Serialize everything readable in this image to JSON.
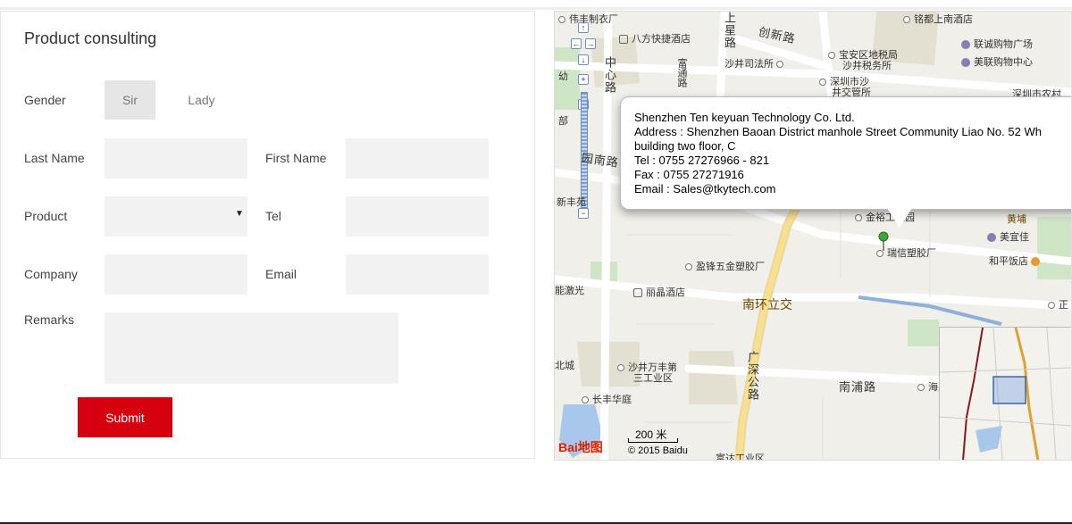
{
  "form": {
    "title": "Product consulting",
    "gender_label": "Gender",
    "gender_sir": "Sir",
    "gender_lady": "Lady",
    "last_name_label": "Last Name",
    "first_name_label": "First Name",
    "product_label": "Product",
    "tel_label": "Tel",
    "company_label": "Company",
    "email_label": "Email",
    "remarks_label": "Remarks",
    "submit_label": "Submit"
  },
  "map": {
    "popup": {
      "company": "Shenzhen Ten keyuan Technology Co. Ltd.",
      "address": "Address : Shenzhen Baoan District manhole Street Community Liao No. 52 Wh",
      "address2": "building two floor, C",
      "tel": "Tel : 0755 27276966 - 821",
      "fax": "Fax : 0755 27271916",
      "email": "Email : Sales@tkytech.com"
    },
    "labels": {
      "l1": "伟丰制衣厂",
      "l2": "八方快捷酒店",
      "l3": "上星路",
      "l4": "创新路",
      "l5": "沙井司法所",
      "l6": "宝安区地税局",
      "l6b": "沙井税务所",
      "l7": "联诚购物广场",
      "l8": "美联购物中心",
      "l9": "中心路",
      "l10": "富通路",
      "l11": "深圳市沙",
      "l11b": "井交管所",
      "l12": "深圳市农村",
      "l13": "园南路",
      "l14": "新丰苑",
      "l15": "金裕工业园",
      "l16": "黄埔",
      "l17": "美宜佳",
      "l18": "瑞信塑胶厂",
      "l19": "盈锋五金塑胶厂",
      "l20": "和平饭店",
      "l21": "能激光",
      "l22": "丽晶酒店",
      "l23": "南环立交",
      "l24": "北城",
      "l25": "沙井万丰第",
      "l25b": "三工业区",
      "l26": "广深公路",
      "l27": "南浦路",
      "l28": "海星电",
      "l29": "长丰华庭",
      "l30": "富达工业区",
      "l31": "铭都上南酒店",
      "l32": "正",
      "l33": "幼",
      "l34": "部"
    },
    "scale": "200 米",
    "logo": "Bai地图",
    "copyright": "© 2015 Baidu"
  }
}
